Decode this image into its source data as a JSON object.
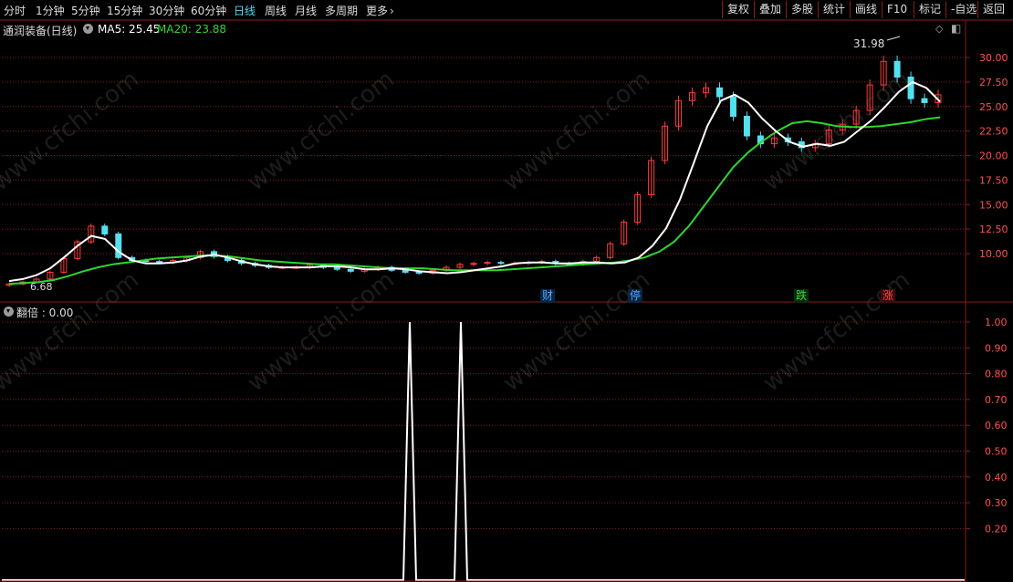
{
  "toolbar": {
    "periods": [
      "分时",
      "1分钟",
      "5分钟",
      "15分钟",
      "30分钟",
      "60分钟",
      "日线",
      "周线",
      "月线",
      "多周期",
      "更多"
    ],
    "active_period": "日线",
    "actions": [
      "复权",
      "叠加",
      "多股",
      "统计",
      "画线",
      "F10",
      "标记",
      "-自选",
      "返回"
    ]
  },
  "main_panel": {
    "stock_title": "通润装备(日线)",
    "ma5_label": "MA5: 25.45",
    "ma20_label": "MA20: 23.88",
    "high_label": "31.98",
    "low_label": "6.68",
    "events": [
      {
        "text": "财",
        "color": "#4aa8ff"
      },
      {
        "text": "停",
        "color": "#4aa8ff"
      },
      {
        "text": "跌",
        "color": "#3bd33b"
      },
      {
        "text": "涨",
        "color": "#ff4040"
      }
    ]
  },
  "sub_panel": {
    "indicator_label": "翻倍 : 0.00"
  },
  "watermark": "www.cfchi.com",
  "colors": {
    "up": "#ff3b3b",
    "down": "#54e0f0",
    "ma5": "#ffffff",
    "ma20": "#2ed62e",
    "grid": "#8a1c1c",
    "axis_text": "#ff5050"
  },
  "chart_data": [
    {
      "type": "candlestick",
      "title": "通润装备(日线)",
      "y_ticks": [
        10.0,
        12.5,
        15.0,
        17.5,
        20.0,
        22.5,
        25.0,
        27.5,
        30.0
      ],
      "ylim": [
        6.0,
        32.5
      ],
      "series": [
        {
          "name": "MA5",
          "last": 25.45,
          "values": [
            7.2,
            7.4,
            7.8,
            8.5,
            9.6,
            10.8,
            11.8,
            11.5,
            10.2,
            9.3,
            9.0,
            9.0,
            9.1,
            9.3,
            9.7,
            9.9,
            9.6,
            9.2,
            8.9,
            8.7,
            8.6,
            8.6,
            8.6,
            8.7,
            8.7,
            8.6,
            8.4,
            8.4,
            8.5,
            8.4,
            8.2,
            8.1,
            8.0,
            8.1,
            8.3,
            8.5,
            8.7,
            9.0,
            9.1,
            9.1,
            9.0,
            9.0,
            9.1,
            9.1,
            9.0,
            9.1,
            9.6,
            10.8,
            12.6,
            15.5,
            19.2,
            23.0,
            25.6,
            26.2,
            25.4,
            23.8,
            22.5,
            21.4,
            20.9,
            21.2,
            21.0,
            21.4,
            22.5,
            23.6,
            25.0,
            26.5,
            27.5,
            26.9,
            25.5
          ]
        },
        {
          "name": "MA20",
          "last": 23.88,
          "values": [
            6.9,
            7.0,
            7.1,
            7.3,
            7.7,
            8.2,
            8.6,
            8.9,
            9.1,
            9.3,
            9.5,
            9.6,
            9.7,
            9.8,
            9.8,
            9.7,
            9.5,
            9.3,
            9.2,
            9.1,
            9.0,
            8.9,
            8.9,
            8.8,
            8.7,
            8.6,
            8.5,
            8.5,
            8.5,
            8.4,
            8.3,
            8.3,
            8.3,
            8.3,
            8.4,
            8.5,
            8.6,
            8.7,
            8.8,
            8.9,
            9.0,
            9.1,
            9.3,
            9.6,
            10.2,
            11.2,
            12.8,
            14.8,
            16.8,
            18.8,
            20.3,
            21.5,
            22.5,
            23.3,
            23.5,
            23.3,
            23.0,
            22.9,
            22.9,
            23.0,
            23.2,
            23.4,
            23.7,
            23.9
          ]
        },
        {
          "name": "close",
          "values": [
            6.9,
            7.1,
            7.4,
            8.1,
            9.5,
            11.2,
            12.8,
            12.0,
            9.6,
            9.3,
            9.2,
            9.1,
            9.3,
            9.6,
            10.2,
            9.7,
            9.3,
            9.0,
            8.8,
            8.6,
            8.6,
            8.6,
            8.8,
            8.6,
            8.4,
            8.2,
            8.4,
            8.6,
            8.3,
            8.1,
            8.0,
            8.3,
            8.6,
            8.9,
            9.0,
            9.1,
            9.0,
            9.0,
            9.1,
            9.2,
            9.0,
            8.9,
            9.2,
            9.6,
            11.0,
            13.2,
            16.0,
            19.5,
            23.0,
            25.6,
            26.4,
            26.9,
            26.0,
            24.0,
            22.0,
            21.2,
            21.8,
            21.4,
            20.8,
            21.2,
            22.6,
            23.2,
            24.6,
            27.2,
            29.6,
            28.0,
            25.8,
            25.4,
            26.2
          ]
        }
      ]
    },
    {
      "type": "line",
      "title": "翻倍",
      "y_ticks": [
        0.2,
        0.3,
        0.4,
        0.5,
        0.6,
        0.7,
        0.8,
        0.9,
        1.0
      ],
      "ylim": [
        0,
        1.0
      ],
      "series": [
        {
          "name": "翻倍",
          "values": [
            0,
            0,
            0,
            0,
            0,
            0,
            0,
            0,
            0,
            0,
            0,
            0,
            0,
            0,
            0,
            0,
            0,
            0,
            0,
            0,
            0,
            0,
            0,
            0,
            0,
            0,
            0,
            0,
            0,
            0,
            0,
            0,
            0,
            0,
            0,
            0,
            0,
            0,
            0,
            0,
            0,
            0,
            0,
            0,
            0,
            0,
            0,
            0,
            0,
            0,
            0,
            0,
            0,
            0,
            0,
            0,
            0,
            0,
            0,
            0,
            0,
            0,
            0,
            0,
            1,
            0,
            0,
            0,
            0,
            1,
            0,
            0,
            0,
            0,
            0
          ]
        }
      ]
    }
  ]
}
